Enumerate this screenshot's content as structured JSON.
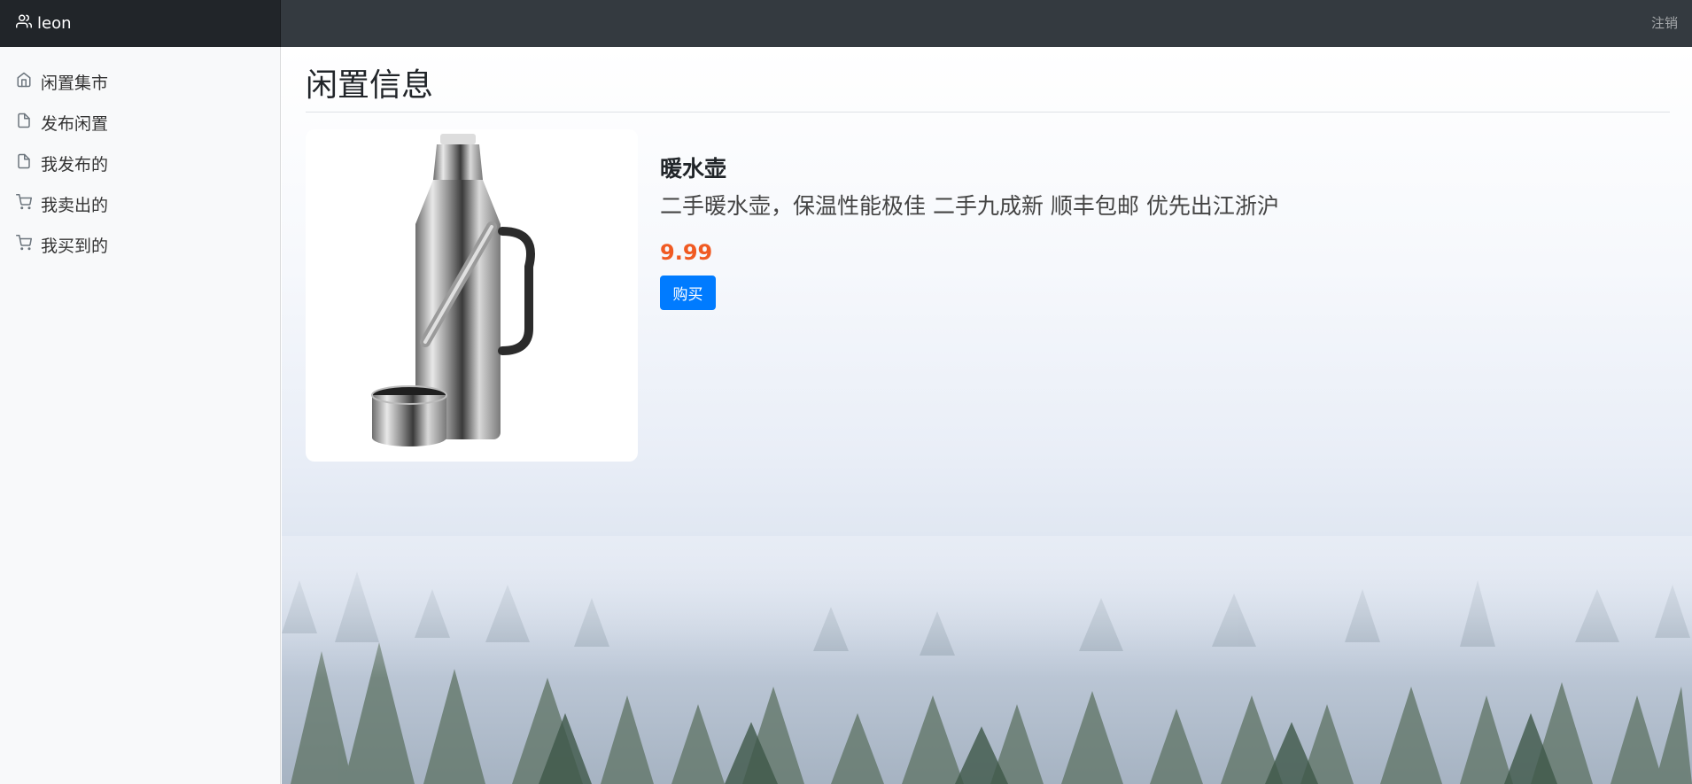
{
  "header": {
    "username": "leon",
    "logout_label": "注销",
    "user_icon": "users-icon"
  },
  "sidebar": {
    "items": [
      {
        "label": "闲置集市",
        "icon": "home-icon"
      },
      {
        "label": "发布闲置",
        "icon": "file-icon"
      },
      {
        "label": "我发布的",
        "icon": "file-icon"
      },
      {
        "label": "我卖出的",
        "icon": "cart-icon"
      },
      {
        "label": "我买到的",
        "icon": "cart-icon"
      }
    ]
  },
  "main": {
    "title": "闲置信息",
    "item": {
      "name": "暖水壶",
      "description": "二手暖水壶，保温性能极佳 二手九成新 顺丰包邮 优先出江浙沪",
      "price": "9.99",
      "buy_label": "购买",
      "image": "thermos-image"
    }
  },
  "colors": {
    "topbar": "#343a40",
    "brand_bg": "#212529",
    "sidebar_bg": "#f8f9fa",
    "price": "#f05a22",
    "primary": "#007bff"
  }
}
